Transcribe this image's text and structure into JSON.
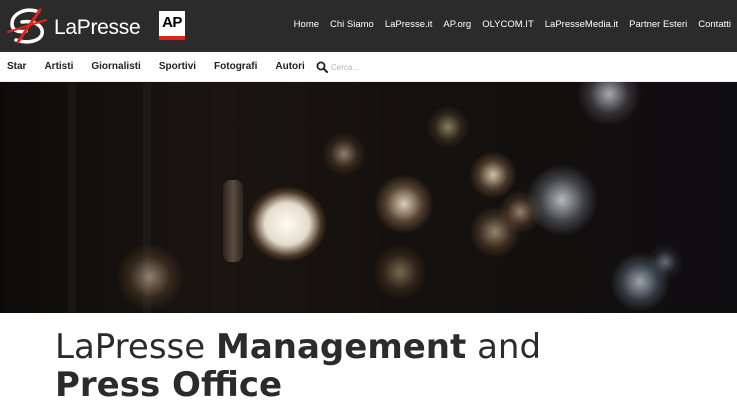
{
  "brand": {
    "logo_text": "LaPresse",
    "partner_badge": "AP",
    "accent_color": "#e2231a"
  },
  "top_nav": {
    "items": [
      {
        "label": "Home"
      },
      {
        "label": "Chi Siamo"
      },
      {
        "label": "LaPresse.it"
      },
      {
        "label": "AP.org"
      },
      {
        "label": "OLYCOM.IT"
      },
      {
        "label": "LaPresseMedia.it"
      },
      {
        "label": "Partner Esteri"
      },
      {
        "label": "Contatti"
      }
    ]
  },
  "sub_nav": {
    "items": [
      {
        "label": "Star"
      },
      {
        "label": "Artisti"
      },
      {
        "label": "Giornalisti"
      },
      {
        "label": "Sportivi"
      },
      {
        "label": "Fotografi"
      },
      {
        "label": "Autori"
      }
    ],
    "search": {
      "icon": "search-icon",
      "placeholder": "Cerca..."
    }
  },
  "hero": {
    "image": "light bulbs with bokeh background"
  },
  "page_title": {
    "part1": "LaPresse ",
    "part2": "Management",
    "part3": " and ",
    "part4": "Press Office"
  }
}
